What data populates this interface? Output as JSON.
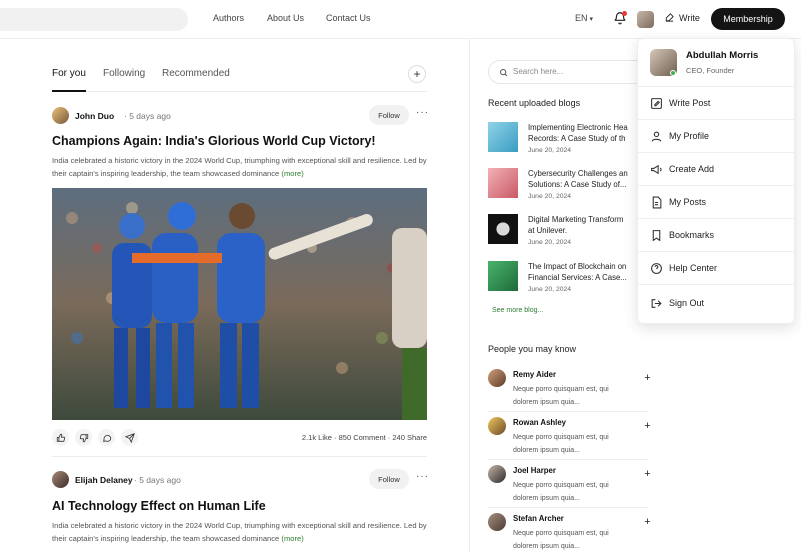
{
  "header": {
    "nav": [
      "Authors",
      "About Us",
      "Contact Us"
    ],
    "lang": "EN",
    "write_label": "Write",
    "membership_label": "Membership"
  },
  "feed": {
    "tabs": [
      "For you",
      "Following",
      "Recommended"
    ],
    "posts": [
      {
        "author": "John Duo",
        "date": "5 days ago",
        "follow": "Follow",
        "title": "Champions Again: India's Glorious World Cup Victory!",
        "body": "India celebrated a historic victory in the 2024 World Cup, triumphing with exceptional skill and resilience. Led by their captain's inspiring leadership, the team showcased dominance",
        "more": "(more)",
        "stats": "2.1k Like · 850 Comment · 240 Share"
      },
      {
        "author": "Elijah Delaney",
        "date": "5 days ago",
        "follow": "Follow",
        "title": "AI Technology Effect on Human Life",
        "body": "India celebrated a historic victory in the 2024 World Cup, triumphing with exceptional skill and resilience. Led by their captain's inspiring leadership, the team showcased dominance",
        "more": "(more)"
      }
    ]
  },
  "sidebar": {
    "search_placeholder": "Search here...",
    "recent_title": "Recent uploaded blogs",
    "blogs": [
      {
        "title_lines": [
          "Implementing Electronic Hea",
          "Records: A Case Study of th"
        ],
        "date": "June 20, 2024"
      },
      {
        "title_lines": [
          "Cybersecurity Challenges an",
          "Solutions: A Case Study of..."
        ],
        "date": "June 20, 2024"
      },
      {
        "title_lines": [
          "Digital Marketing Transform",
          "at Unilever."
        ],
        "date": "June 20, 2024"
      },
      {
        "title_lines": [
          "The Impact of Blockchain on",
          "Financial Services: A Case..."
        ],
        "date": "June 20, 2024"
      }
    ],
    "see_more": "See more blog...",
    "people_title": "People you may know",
    "people": [
      {
        "name": "Remy Aider",
        "desc": "Neque porro quisquam est, qui dolorem ipsum quia..."
      },
      {
        "name": "Rowan Ashley",
        "desc": "Neque porro quisquam est, qui dolorem ipsum quia..."
      },
      {
        "name": "Joel Harper",
        "desc": "Neque porro quisquam est, qui dolorem ipsum quia..."
      },
      {
        "name": "Stefan Archer",
        "desc": "Neque porro quisquam est, qui dolorem ipsum quia..."
      }
    ]
  },
  "dropdown": {
    "name": "Abdullah Morris",
    "role": "CEO, Founder",
    "items": [
      "Write Post",
      "My Profile",
      "Create Add",
      "My Posts",
      "Bookmarks",
      "Help Center",
      "Sign Out"
    ]
  },
  "colors": {
    "accent_green": "#2e7d32",
    "dark_button": "#141414",
    "notification_dot": "#e53935",
    "online": "#3bb54a"
  }
}
